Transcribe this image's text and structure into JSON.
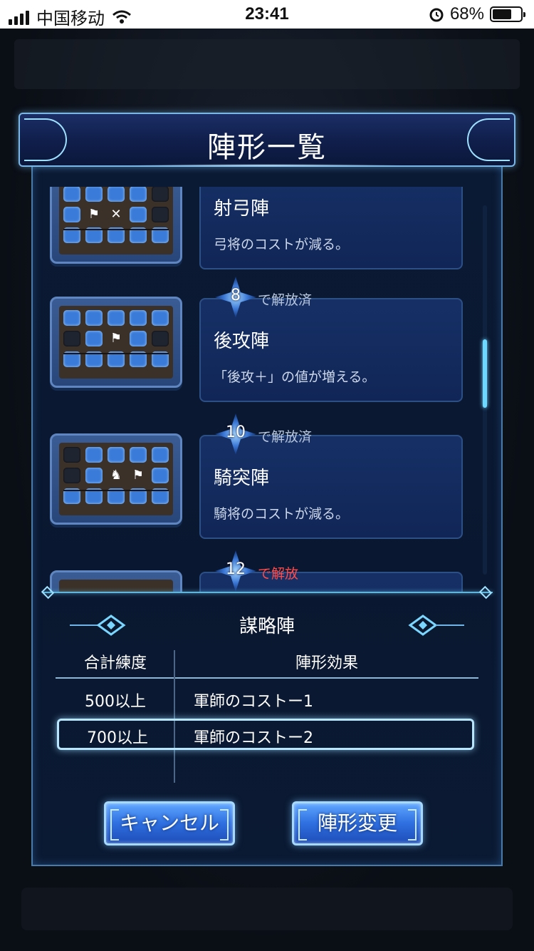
{
  "status_bar": {
    "carrier": "中国移动",
    "time": "23:41",
    "battery_percent": "68%",
    "battery_level": 0.68
  },
  "dialog": {
    "title": "陣形一覧"
  },
  "formations": [
    {
      "name": "射弓陣",
      "effect": "弓将のコストが減る。",
      "badge_number": "",
      "badge_label": "",
      "slots": [
        "blue",
        "blue",
        "flag",
        "bow",
        "blue",
        "dark",
        "blue",
        "blue",
        "blue",
        "blue"
      ]
    },
    {
      "name": "後攻陣",
      "effect": "「後攻＋」の値が増える。",
      "badge_number": "8",
      "badge_label": "で解放済"
    },
    {
      "name": "騎突陣",
      "effect": "騎将のコストが減る。",
      "badge_number": "10",
      "badge_label": "で解放済"
    },
    {
      "name": "",
      "effect": "",
      "badge_number": "12",
      "badge_label": "で解放"
    }
  ],
  "detail": {
    "title": "謀略陣",
    "col_total": "合計練度",
    "col_effect": "陣形効果",
    "rows": [
      {
        "total": "500以上",
        "effect": "軍師のコストー1"
      },
      {
        "total": "700以上",
        "effect": "軍師のコストー2"
      }
    ]
  },
  "buttons": {
    "cancel": "キャンセル",
    "change": "陣形変更"
  },
  "colors": {
    "accent": "#6fd8ff",
    "locked_label": "#ff4b4b",
    "button": "#2f6fe0"
  }
}
